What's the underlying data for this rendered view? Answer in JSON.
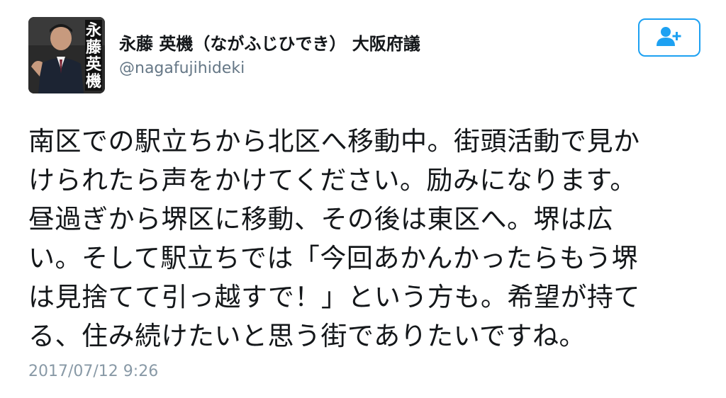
{
  "user": {
    "display_name": "永藤 英機（ながふじひでき） 大阪府議",
    "handle": "@nagafujihideki",
    "avatar_caption": "永藤英機",
    "follow_icon": "add-user-icon",
    "accent_color": "#1da1f2"
  },
  "tweet": {
    "lines": [
      "南区での駅立ちから北区へ移動中。街頭活動で見か",
      "けられたら声をかけてください。励みになります。",
      "昼過ぎから堺区に移動、その後は東区へ。堺は広",
      "い。そして駅立ちでは「今回あかんかったらもう堺",
      "は見捨てて引っ越すで！」という方も。希望が持て",
      "る、住み続けたいと思う街でありたいですね。"
    ],
    "timestamp": "2017/07/12 9:26"
  }
}
